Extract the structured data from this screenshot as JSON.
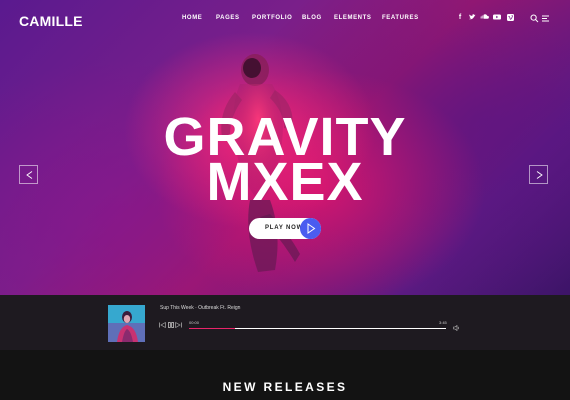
{
  "header": {
    "logo": "CAMILLE",
    "nav": [
      "HOME",
      "PAGES",
      "PORTFOLIO",
      "BLOG",
      "ELEMENTS",
      "FEATURES"
    ],
    "social": [
      "facebook-icon",
      "twitter-icon",
      "soundcloud-icon",
      "youtube-icon",
      "vimeo-icon"
    ],
    "tools": [
      "search-icon",
      "menu-icon"
    ]
  },
  "hero": {
    "title_line1": "GRAVITY",
    "title_line2": "MXEX",
    "cta": "PLAY NOW"
  },
  "player": {
    "track": "Sup This Week · Outbreak Ft. Reign",
    "time_current": "00:00",
    "time_total": "3:45",
    "progress": 0.18
  },
  "section": {
    "title": "NEW RELEASES"
  },
  "colors": {
    "accent": "#e8256a",
    "play_circle": "#4a5cf0"
  }
}
